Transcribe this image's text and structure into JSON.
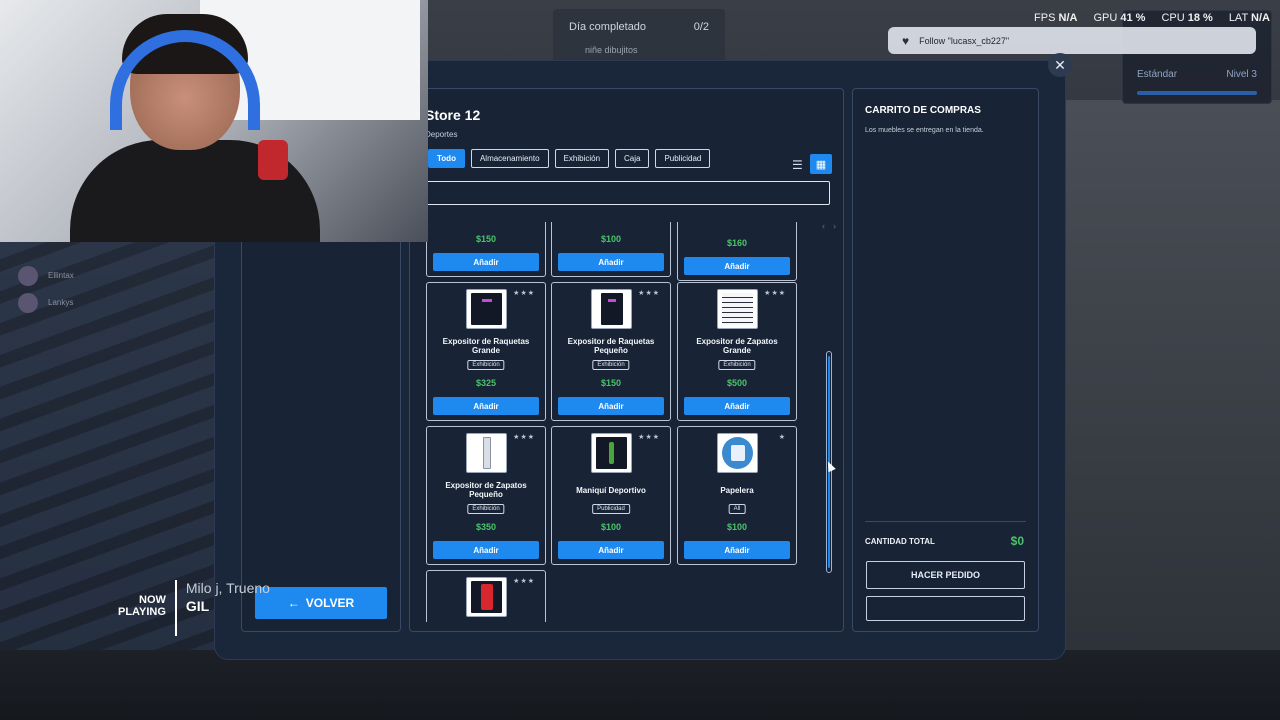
{
  "hud": {
    "fps_label": "FPS",
    "fps_value": "N/A",
    "gpu_label": "GPU",
    "gpu_value": "41 %",
    "cpu_label": "CPU",
    "cpu_value": "18 %",
    "lat_label": "LAT",
    "lat_value": "N/A"
  },
  "quest": {
    "title": "Día completado",
    "progress": "0/2",
    "subtitle": "niñe dibujitos"
  },
  "level": {
    "rank": "Estándar",
    "level": "Nivel 3"
  },
  "toast": {
    "text": "Follow \"lucasx_cb227\""
  },
  "chatters": [
    "Ellintax",
    "Lankys"
  ],
  "now_playing": {
    "label_line1": "NOW",
    "label_line2": "PLAYING",
    "artist": "Milo j, Trueno",
    "title": "GIL"
  },
  "shop": {
    "close_label": "✕",
    "back_label": "VOLVER",
    "store_title": "Store 12",
    "store_subtitle": "Deportes",
    "filters": [
      "Todo",
      "Almacenamiento",
      "Exhibición",
      "Caja",
      "Publicidad"
    ],
    "paging_prev": "‹",
    "paging_next": "›",
    "add_label": "Añadir",
    "top_row": [
      {
        "price": "$150"
      },
      {
        "price": "$100"
      },
      {
        "price": "$160"
      }
    ],
    "items": [
      {
        "name": "Expositor de Raquetas Grande",
        "category": "Exhibición",
        "price": "$325",
        "stars": "★★★"
      },
      {
        "name": "Expositor de Raquetas Pequeño",
        "category": "Exhibición",
        "price": "$150",
        "stars": "★★★"
      },
      {
        "name": "Expositor de Zapatos Grande",
        "category": "Exhibición",
        "price": "$500",
        "stars": "★★★"
      },
      {
        "name": "Expositor de Zapatos Pequeño",
        "category": "Exhibición",
        "price": "$350",
        "stars": "★★★"
      },
      {
        "name": "Maniquí Deportivo",
        "category": "Publicidad",
        "price": "$100",
        "stars": "★★★"
      },
      {
        "name": "Papelera",
        "category": "All",
        "price": "$100",
        "stars": "★"
      }
    ],
    "last_item": {
      "stars": "★★★"
    }
  },
  "cart": {
    "title": "CARRITO DE COMPRAS",
    "note": "Los muebles se entregan en la tienda.",
    "total_label": "CANTIDAD TOTAL",
    "total_value": "$0",
    "order_label": "HACER PEDIDO"
  }
}
